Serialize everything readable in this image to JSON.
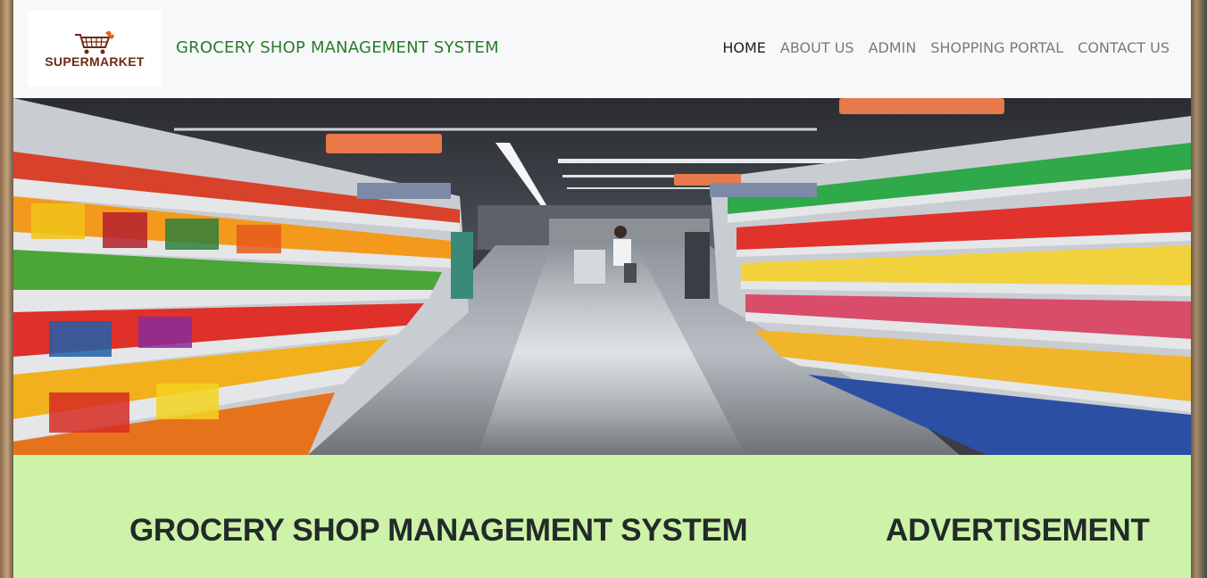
{
  "logo": {
    "text": "SUPERMARKET",
    "icon": "shopping-cart-icon",
    "accent": "#e0631a",
    "text_color": "#6b2b12"
  },
  "navbar": {
    "brand": "GROCERY SHOP MANAGEMENT SYSTEM",
    "brand_color": "#2b7a2b",
    "links": [
      {
        "label": "HOME",
        "active": true
      },
      {
        "label": "ABOUT US",
        "active": false
      },
      {
        "label": "ADMIN",
        "active": false
      },
      {
        "label": "SHOPPING PORTAL",
        "active": false
      },
      {
        "label": "CONTACT US",
        "active": false
      }
    ]
  },
  "hero": {
    "image": "supermarket-aisle-photo"
  },
  "main": {
    "title": "GROCERY SHOP MANAGEMENT SYSTEM",
    "ad_title": "ADVERTISEMENT",
    "background": "#cdf3a8"
  }
}
